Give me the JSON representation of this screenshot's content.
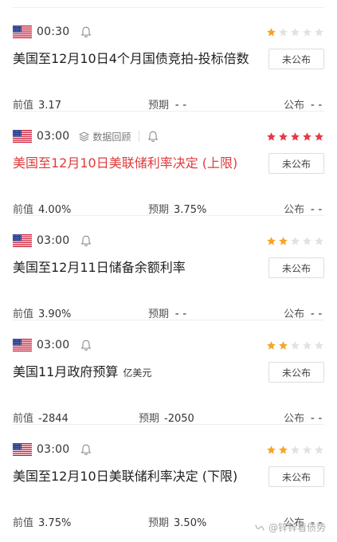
{
  "colors": {
    "important_text": "#e03a3a",
    "star_active_orange": "#f5a623",
    "star_active_red": "#e63946",
    "star_inactive": "#e2e2e2"
  },
  "events": [
    {
      "time": "00:30",
      "title": "美国至12月10日4个月国债竞拍-投标倍数",
      "title_unit": "",
      "important": false,
      "has_replay": false,
      "stars": 1,
      "status": "未公布",
      "prev_label": "前值",
      "prev_value": "3.17",
      "forecast_label": "预期",
      "forecast_value": "--",
      "published_label": "公布",
      "published_value": "--"
    },
    {
      "time": "03:00",
      "replay_label": "数据回顾",
      "title": "美国至12月10日美联储利率决定 (上限)",
      "title_unit": "",
      "important": true,
      "has_replay": true,
      "stars": 5,
      "status": "未公布",
      "prev_label": "前值",
      "prev_value": "4.00%",
      "forecast_label": "预期",
      "forecast_value": "3.75%",
      "published_label": "公布",
      "published_value": "--"
    },
    {
      "time": "03:00",
      "title": "美国至12月11日储备余额利率",
      "title_unit": "",
      "important": false,
      "has_replay": false,
      "stars": 2,
      "status": "未公布",
      "prev_label": "前值",
      "prev_value": "3.90%",
      "forecast_label": "预期",
      "forecast_value": "--",
      "published_label": "公布",
      "published_value": "--"
    },
    {
      "time": "03:00",
      "title": "美国11月政府预算",
      "title_unit": "亿美元",
      "important": false,
      "has_replay": false,
      "stars": 2,
      "status": "未公布",
      "prev_label": "前值",
      "prev_value": "-2844",
      "forecast_label": "预期",
      "forecast_value": "-2050",
      "published_label": "公布",
      "published_value": "--"
    },
    {
      "time": "03:00",
      "title": "美国至12月10日美联储利率决定 (下限)",
      "title_unit": "",
      "important": false,
      "has_replay": false,
      "stars": 2,
      "status": "未公布",
      "prev_label": "前值",
      "prev_value": "3.75%",
      "forecast_label": "预期",
      "forecast_value": "3.50%",
      "published_label": "公布",
      "published_value": "--"
    }
  ],
  "watermark": {
    "text": "@锌锌看债势",
    "icon": "wechat-channel-icon"
  }
}
